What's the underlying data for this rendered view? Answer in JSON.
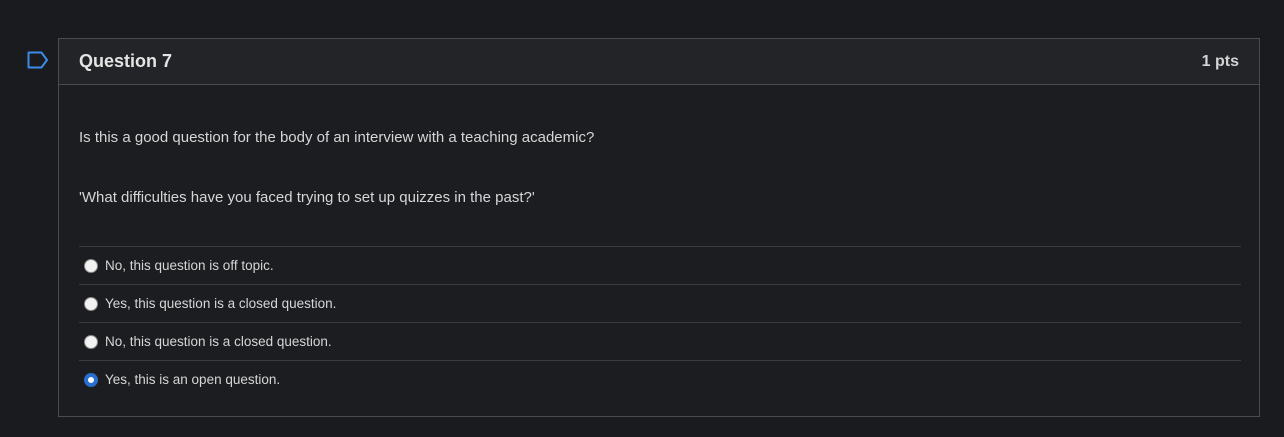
{
  "question": {
    "title": "Question 7",
    "points": "1 pts",
    "prompt": "Is this a good question for the body of an interview with a teaching academic?",
    "quote": "'What difficulties have you faced trying to set up quizzes in the past?'",
    "answers": [
      {
        "label": "No, this question is off topic.",
        "selected": false
      },
      {
        "label": "Yes, this question is a closed question.",
        "selected": false
      },
      {
        "label": "No, this question is a closed question.",
        "selected": false
      },
      {
        "label": "Yes, this is an open question.",
        "selected": true
      }
    ]
  },
  "icons": {
    "flag": "bookmark-flag-icon"
  },
  "colors": {
    "accent": "#2a6fcf",
    "background": "#1a1b1e"
  }
}
